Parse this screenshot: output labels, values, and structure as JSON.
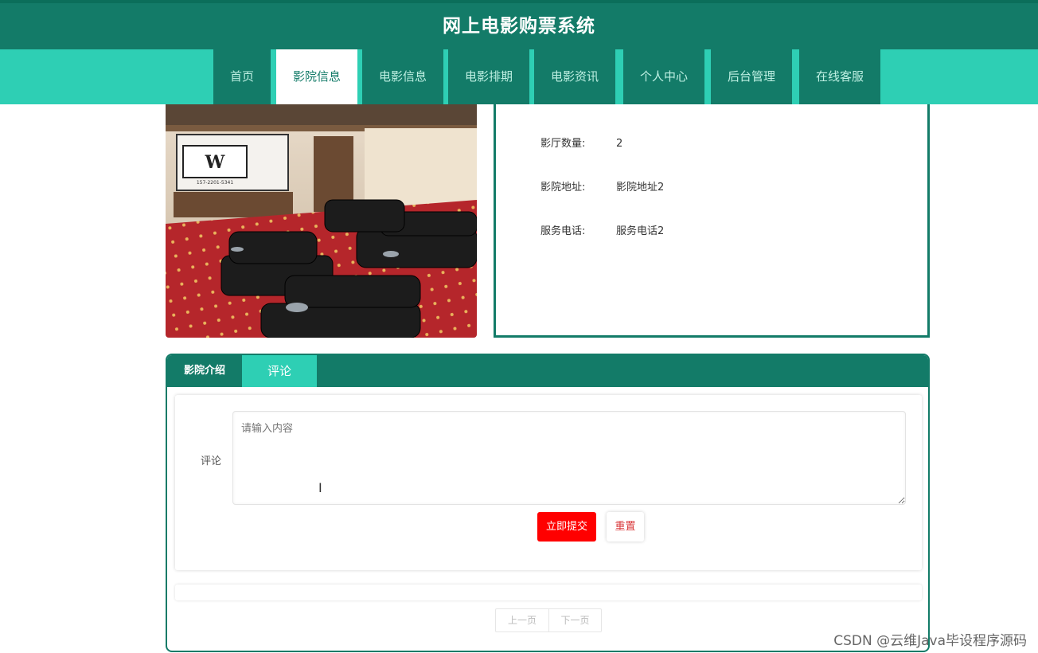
{
  "header": {
    "title": "网上电影购票系统"
  },
  "nav": {
    "items": [
      {
        "label": "首页"
      },
      {
        "label": "影院信息"
      },
      {
        "label": "电影信息"
      },
      {
        "label": "电影排期"
      },
      {
        "label": "电影资讯"
      },
      {
        "label": "个人中心"
      },
      {
        "label": "后台管理"
      },
      {
        "label": "在线客服"
      }
    ],
    "active_label": "影院信息"
  },
  "cinema": {
    "poster_text": "157-2201-5341",
    "fields": [
      {
        "label": "影厅数量:",
        "value": "2"
      },
      {
        "label": "影院地址:",
        "value": "影院地址2"
      },
      {
        "label": "服务电话:",
        "value": "服务电话2"
      }
    ]
  },
  "tabs": [
    {
      "label": "影院介绍"
    },
    {
      "label": "评论"
    }
  ],
  "active_tab": "评论",
  "comment_form": {
    "label": "评论",
    "placeholder": "请输入内容",
    "submit_label": "立即提交",
    "reset_label": "重置"
  },
  "pager": {
    "prev_label": "上一页",
    "next_label": "下一页"
  },
  "watermark": "CSDN @云维Java毕设程序源码",
  "colors": {
    "primary": "#137b68",
    "accent": "#2ecfb4",
    "submit": "#ff0000"
  },
  "icons": {
    "text_cursor": "I-beam-cursor-icon"
  }
}
